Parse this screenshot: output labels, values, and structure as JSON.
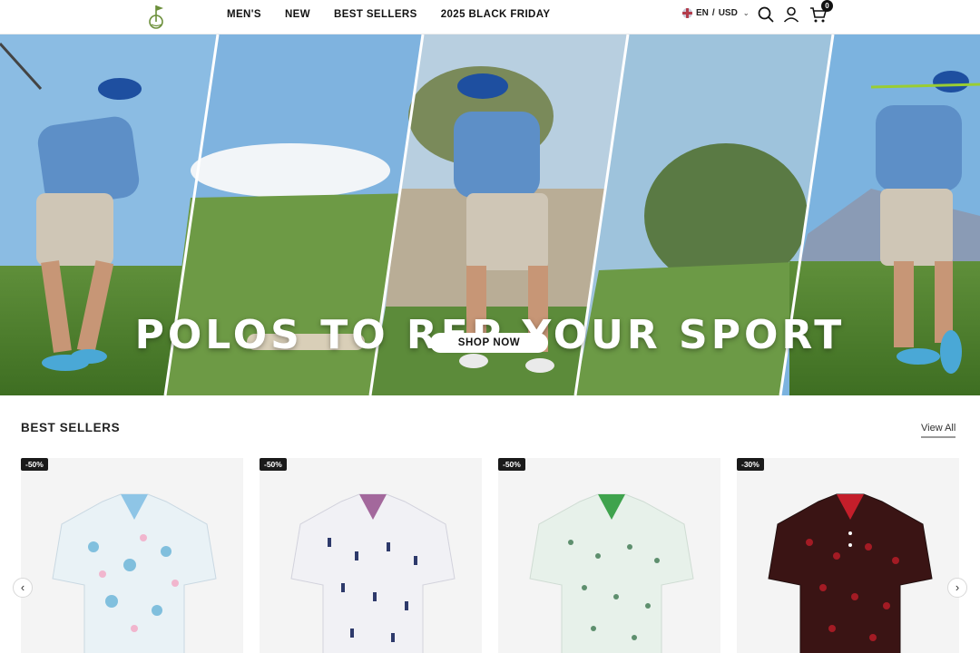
{
  "header": {
    "logo_icon": "golf-flag-logo-icon",
    "nav": [
      "MEN'S",
      "NEW",
      "BEST SELLERS",
      "2025 BLACK FRIDAY"
    ],
    "locale": {
      "language": "EN",
      "separator": "/",
      "currency": "USD"
    },
    "icons": [
      "search-icon",
      "account-icon",
      "cart-icon"
    ],
    "cart_count": "0"
  },
  "hero": {
    "title": "POLOS TO REP YOUR SPORT",
    "cta": "SHOP NOW",
    "slides_dots": 1
  },
  "best_sellers": {
    "title": "BEST SELLERS",
    "view_all": "View All",
    "products": [
      {
        "discount": "-50%",
        "pattern": "palm-pastel",
        "color": "#e9f2f6"
      },
      {
        "discount": "-50%",
        "pattern": "navy-icons-white",
        "color": "#f1f1f5"
      },
      {
        "discount": "-50%",
        "pattern": "mint-trees",
        "color": "#e7f1ea"
      },
      {
        "discount": "-30%",
        "pattern": "red-black-pattern",
        "color": "#3a1414"
      }
    ]
  },
  "carousel": {
    "prev_icon": "chevron-left-icon",
    "next_icon": "chevron-right-icon"
  }
}
